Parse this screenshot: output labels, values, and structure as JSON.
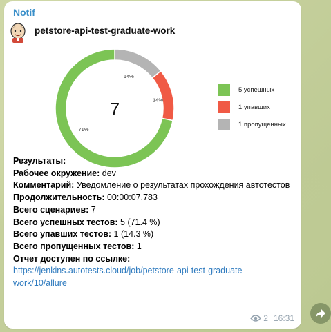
{
  "message": {
    "sender": "Notif",
    "card_title": "petstore-api-test-graduate-work",
    "views": "2",
    "time": "16:31",
    "logo_icon": "jenkins-butler-icon",
    "forward_icon": "forward-arrow-icon"
  },
  "chart_data": {
    "type": "pie",
    "center_label": "7",
    "slices": [
      {
        "label": "5 успешных",
        "value": 71,
        "pct_label": "71%",
        "color": "#7cc455"
      },
      {
        "label": "1 упавших",
        "value": 14,
        "pct_label": "14%",
        "color": "#f05a45"
      },
      {
        "label": "1 пропущенных",
        "value": 14,
        "pct_label": "14%",
        "color": "#b4b4b4"
      }
    ],
    "legend_position": "right"
  },
  "info": {
    "results_label": "Результаты:",
    "env_label": "Рабочее окружение:",
    "env_value": "dev",
    "comment_label": "Комментарий:",
    "comment_value": "Уведомление о результатах прохождения автотестов",
    "duration_label": "Продолжительность:",
    "duration_value": "00:00:07.783",
    "scenarios_label": "Всего сценариев:",
    "scenarios_value": "7",
    "passed_label": "Всего успешных тестов:",
    "passed_value": "5 (71.4 %)",
    "failed_label": "Всего упавших тестов:",
    "failed_value": "1 (14.3 %)",
    "skipped_label": "Всего пропущенных тестов:",
    "skipped_value": "1",
    "report_label": "Отчет доступен по ссылке:",
    "report_link": "https://jenkins.autotests.cloud/job/petstore-api-test-graduate-work/10/allure"
  }
}
